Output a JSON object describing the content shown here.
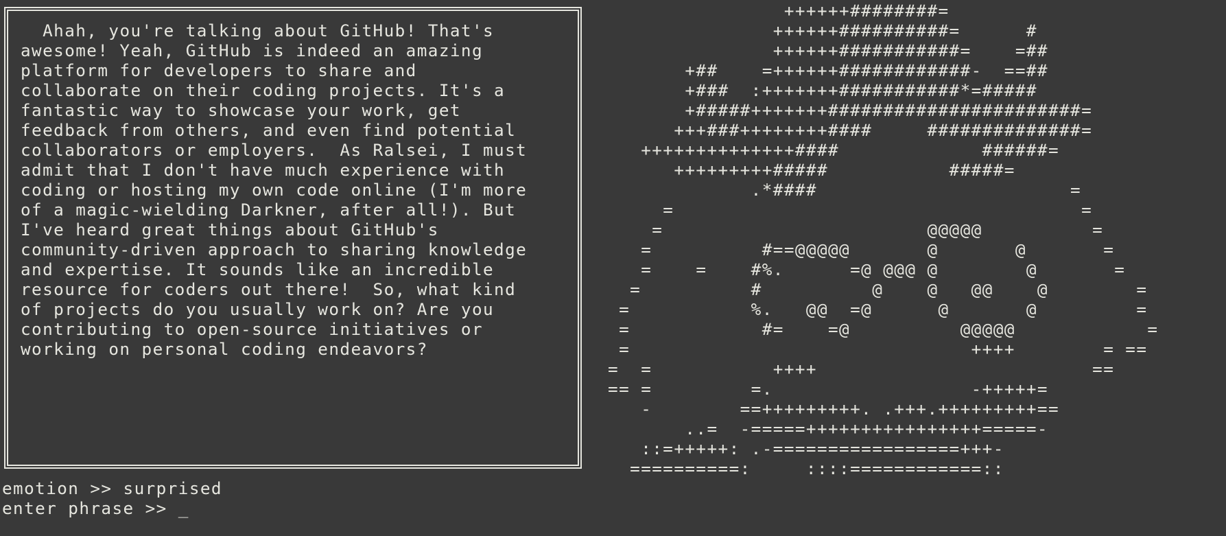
{
  "dialog": {
    "text": "  Ahah, you're talking about GitHub! That's\nawesome! Yeah, GitHub is indeed an amazing\nplatform for developers to share and\ncollaborate on their coding projects. It's a\nfantastic way to showcase your work, get\nfeedback from others, and even find potential\ncollaborators or employers.  As Ralsei, I must\nadmit that I don't have much experience with\ncoding or hosting my own code online (I'm more\nof a magic-wielding Darkner, after all!). But\nI've heard great things about GitHub's\ncommunity-driven approach to sharing knowledge\nand expertise. It sounds like an incredible\nresource for coders out there!  So, what kind\nof projects do you usually work on? Are you\ncontributing to open-source initiatives or\nworking on personal coding endeavors?"
  },
  "ascii_art": {
    "text": "                 ++++++########=\n                ++++++##########=      #\n                ++++++###########=    =##\n        +##    =++++++############-  ==##\n        +###  :+++++++###########*=#####\n        +#####+++++++#######################=\n       +++###++++++++####     ##############=\n    ++++++++++++++####             ######=\n       +++++++++#####           #####=\n              .*####                       =\n      =                                     =\n     =                        @@@@@          =\n    =          #==@@@@@       @       @       =\n    =    =    #%.      =@ @@@ @        @       =\n   =          #          @    @   @@    @        =\n  =           %.   @@  =@      @       @         =\n  =            #=    =@          @@@@@            =\n  =                               ++++        = ==\n =  =           ++++                         ==\n == =         =.                  -+++++=\n    -        ==+++++++++. .+++.+++++++++==\n        ..=  -=====++++++++++++++++=====-\n    ::=+++++: .-=================+++-\n   ==========:     ::::============::"
  },
  "status": {
    "emotion_line": "emotion >> surprised",
    "prompt_label": "enter phrase >> ",
    "prompt_cursor": "_"
  },
  "colors": {
    "background": "#393939",
    "foreground": "#e6e6df"
  }
}
